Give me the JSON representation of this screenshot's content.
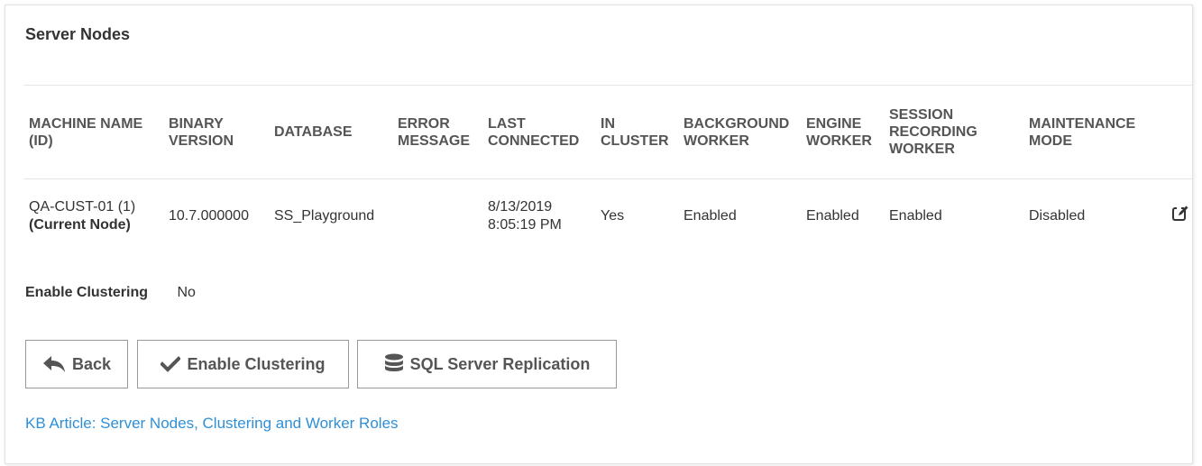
{
  "panel": {
    "title": "Server Nodes"
  },
  "table": {
    "columns": [
      "MACHINE NAME\n(ID)",
      "BINARY\nVERSION",
      "DATABASE",
      "ERROR\nMESSAGE",
      "LAST\nCONNECTED",
      "IN\nCLUSTER",
      "BACKGROUND\nWORKER",
      "ENGINE\nWORKER",
      "SESSION\nRECORDING\nWORKER",
      "MAINTENANCE\nMODE"
    ],
    "rows": [
      {
        "machine_name": "QA-CUST-01 (1)",
        "node_tag": "(Current Node)",
        "binary_version": "10.7.000000",
        "database": "SS_Playground",
        "error_message": "",
        "last_connected_date": "8/13/2019",
        "last_connected_time": "8:05:19 PM",
        "in_cluster": "Yes",
        "background_worker": "Enabled",
        "engine_worker": "Enabled",
        "session_recording_worker": "Enabled",
        "maintenance_mode": "Disabled",
        "edit_icon": "edit-icon"
      }
    ]
  },
  "clustering": {
    "label": "Enable Clustering",
    "value": "No"
  },
  "buttons": {
    "back": "Back",
    "enable_clustering": "Enable Clustering",
    "sql_replication": "SQL Server Replication"
  },
  "kb_link": "KB Article: Server Nodes, Clustering and Worker Roles",
  "colors": {
    "link": "#2f8fd6",
    "button_border": "#999999",
    "text": "#333333",
    "header_text": "#555555"
  }
}
